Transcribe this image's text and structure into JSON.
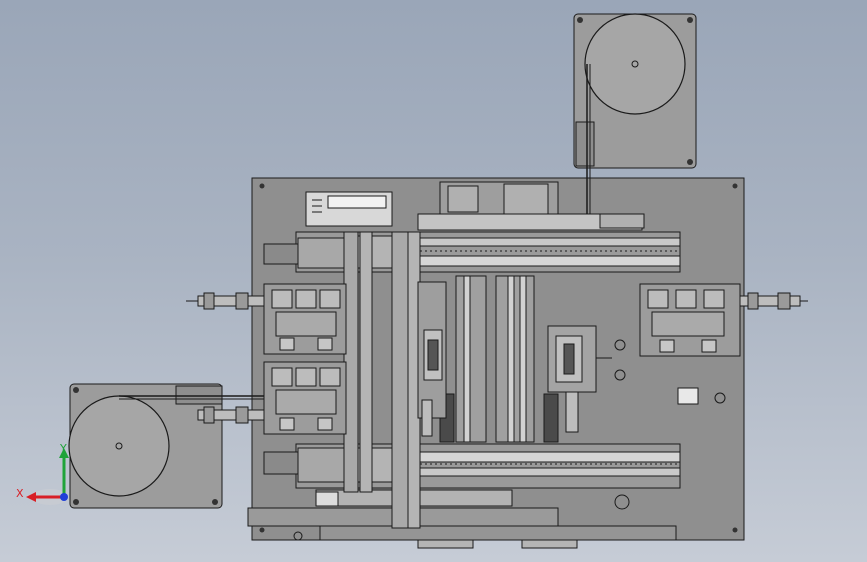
{
  "triad": {
    "x_label": "X",
    "y_label": "Y",
    "x_color": "#d81f26",
    "y_color": "#1fa33a",
    "z_color": "#1f3fd8"
  },
  "colors": {
    "background_top": "#9aa6b8",
    "background_bottom": "#c6ccd6",
    "frame": "#8c8c8c",
    "part": "#a3a3a3",
    "line": "#1a1a1a"
  }
}
